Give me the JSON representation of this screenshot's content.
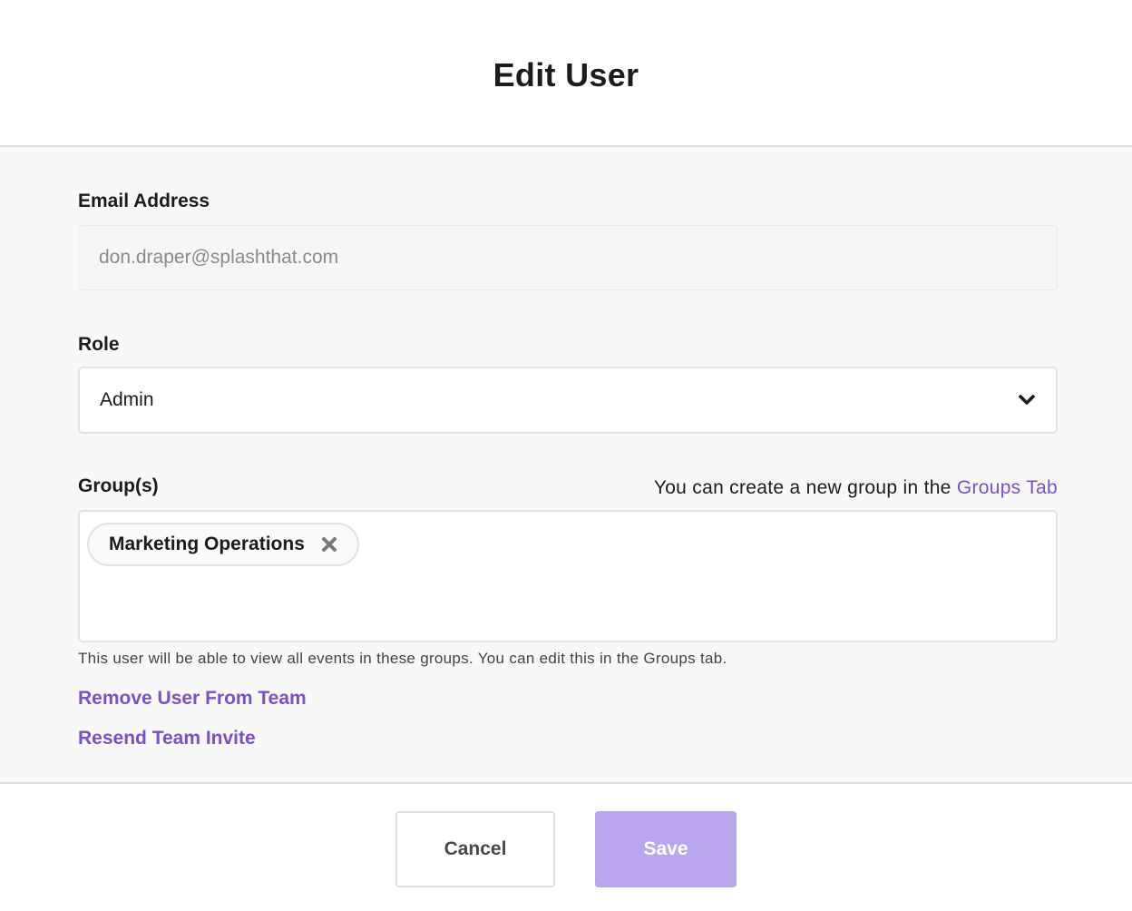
{
  "modal": {
    "title": "Edit User"
  },
  "email": {
    "label": "Email Address",
    "value": "don.draper@splashthat.com"
  },
  "role": {
    "label": "Role",
    "selected": "Admin",
    "icon": "chevron-down-icon"
  },
  "groups": {
    "label": "Group(s)",
    "hint_prefix": "You can create a new group in the ",
    "hint_link": "Groups Tab",
    "chips": [
      {
        "label": "Marketing Operations",
        "remove_icon": "close-icon"
      }
    ],
    "helper": "This user will be able to view all events in these groups. You can edit this in the Groups tab."
  },
  "actions": {
    "remove_user": "Remove User From Team",
    "resend_invite": "Resend Team Invite"
  },
  "footer": {
    "cancel_label": "Cancel",
    "save_label": "Save"
  },
  "colors": {
    "accent": "#7b4fd0",
    "save_disabled": "#b9a4ee",
    "body_bg": "#f8f8f8"
  }
}
